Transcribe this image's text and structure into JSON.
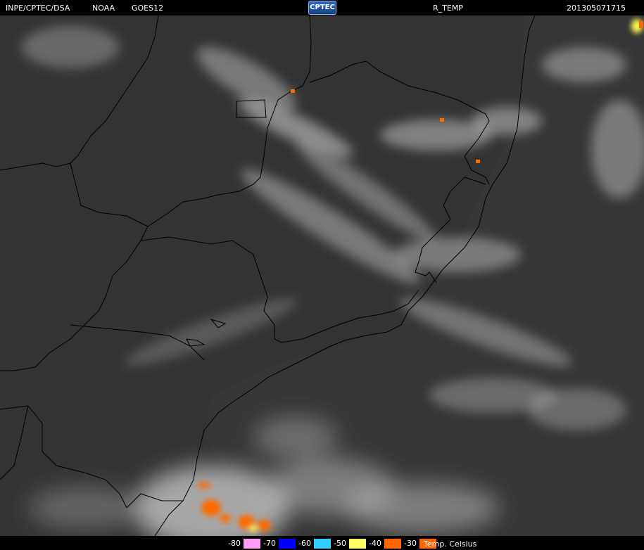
{
  "header": {
    "source": "INPE/CPTEC/DSA",
    "agency": "NOAA",
    "satellite": "GOES12",
    "logo_text": "CPTEC",
    "product": "R_TEMP",
    "timestamp": "201305071715"
  },
  "legend": {
    "title": "Temp. Celsius",
    "entries": [
      {
        "label": "-80",
        "color": "#ff9cf5"
      },
      {
        "label": "-70",
        "color": "#0000ff"
      },
      {
        "label": "-60",
        "color": "#33ccff"
      },
      {
        "label": "-50",
        "color": "#ffff66"
      },
      {
        "label": "-40",
        "color": "#ff6600"
      },
      {
        "label": "-30",
        "color": "#ff6600"
      }
    ]
  },
  "colors": {
    "background": "#000000",
    "land_base": "#3b3b3b",
    "ocean_base": "#353535",
    "cloud": "#d8d8d8",
    "boundary": "#000000",
    "cold_top": "#ff6a00"
  }
}
